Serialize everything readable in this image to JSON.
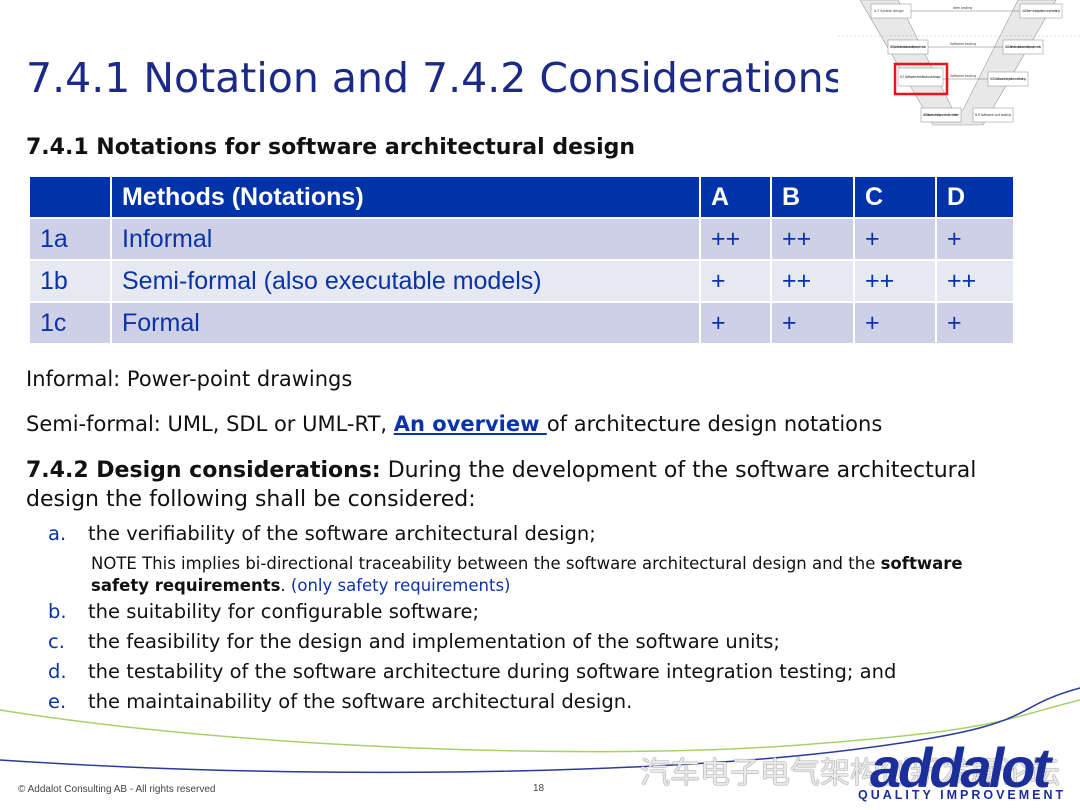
{
  "title": "7.4.1 Notation and 7.4.2 Considerations",
  "subtitle": "7.4.1 Notations for software architectural design",
  "table": {
    "headers": [
      "",
      "Methods (Notations)",
      "A",
      "B",
      "C",
      "D"
    ],
    "rows": [
      [
        "1a",
        "Informal",
        "++",
        "++",
        "+",
        "+"
      ],
      [
        "1b",
        "Semi-formal (also executable models)",
        "+",
        "++",
        "++",
        "++"
      ],
      [
        "1c",
        "Formal",
        "+",
        "+",
        "+",
        "+"
      ]
    ]
  },
  "informal_text": "Informal: Power-point drawings",
  "semiformal": {
    "prefix": "Semi-formal: UML, SDL or UML-RT, ",
    "link": "An overview ",
    "suffix": "of architecture design notations"
  },
  "considerations": {
    "heading": "7.4.2 Design considerations:",
    "intro_line1": " During the development of the software architectural",
    "intro_line2": "design the following shall be considered:",
    "items": [
      {
        "marker": "a.",
        "text": "the verifiability of the software architectural design;"
      },
      {
        "marker": "b.",
        "text": "the suitability for configurable software;"
      },
      {
        "marker": "c.",
        "text": "the feasibility for the design and implementation of the software units;"
      },
      {
        "marker": "d.",
        "text": "the testability of the software architecture during software integration testing; and"
      },
      {
        "marker": "e.",
        "text": "the maintainability of the software architectural design."
      }
    ],
    "note": {
      "prefix": "NOTE This implies bi-directional traceability between the software architectural design and the ",
      "bold": "software safety requirements",
      "period": ".",
      "aside": " (only safety requirements)"
    }
  },
  "vmodel": {
    "boxes": [
      "4-7 System design",
      "6-6 Specification of software safety requirements",
      "6-7 Software architectural design",
      "6-8 Software unit design and implementation",
      "4-8 Item integration and testing",
      "6-11 Verification of software safety requirements",
      "6-10 Software integration and testing",
      "6-9 Software unit testing"
    ],
    "arrows": [
      "Item testing",
      "Software testing",
      "Software testing"
    ],
    "highlight_color": "#e8141b"
  },
  "footer": {
    "copyright": "© Addalot Consulting AB -  All rights reserved",
    "page": "18"
  },
  "logo": {
    "name": "addalot",
    "tagline": "QUALITY IMPROVEMENT"
  },
  "watermark": "汽车电子电气架构创新发展论坛",
  "colors": {
    "title": "#1a2a86",
    "table_header": "#0033aa",
    "row_dark": "#cdd0e6",
    "row_light": "#e6e8f2",
    "green_swoosh": "#a6d16a",
    "blue_swoosh": "#2a3a9a"
  }
}
